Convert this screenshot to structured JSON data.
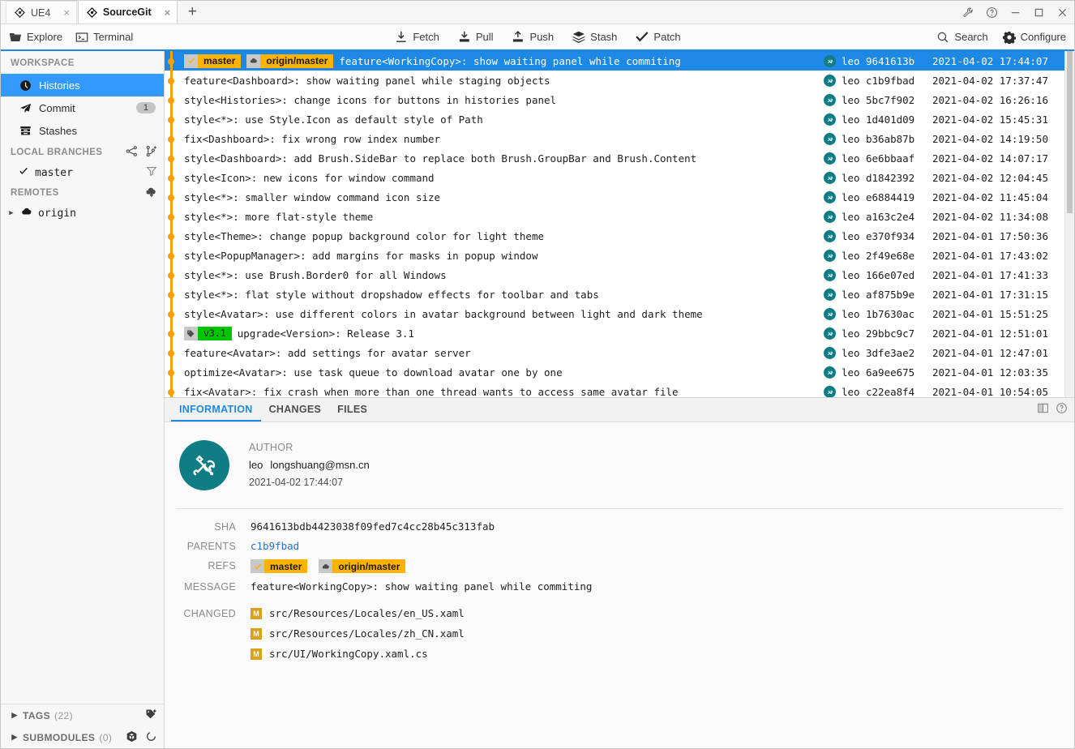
{
  "window": {
    "tabs": [
      {
        "label": "UE4",
        "active": false,
        "icon": "git-logo-icon"
      },
      {
        "label": "SourceGit",
        "active": true,
        "icon": "git-logo-icon"
      }
    ],
    "new_tab_label": "+",
    "close_label": "×",
    "controls": [
      "wrench-icon",
      "help-icon",
      "minimize-icon",
      "maximize-icon",
      "close-icon"
    ]
  },
  "toolbar": {
    "left": [
      {
        "label": "Explore",
        "icon": "folder-icon"
      },
      {
        "label": "Terminal",
        "icon": "terminal-icon"
      }
    ],
    "center": [
      {
        "label": "Fetch",
        "icon": "fetch-icon"
      },
      {
        "label": "Pull",
        "icon": "pull-icon"
      },
      {
        "label": "Push",
        "icon": "push-icon"
      },
      {
        "label": "Stash",
        "icon": "stash-icon"
      },
      {
        "label": "Patch",
        "icon": "patch-icon"
      }
    ],
    "right": [
      {
        "label": "Search",
        "icon": "search-icon"
      },
      {
        "label": "Configure",
        "icon": "gear-icon"
      }
    ]
  },
  "sidebar": {
    "workspace_title": "WORKSPACE",
    "workspace_items": [
      {
        "label": "Histories",
        "icon": "clock-icon",
        "active": true,
        "badge": ""
      },
      {
        "label": "Commit",
        "icon": "paper-plane-icon",
        "active": false,
        "badge": "1"
      },
      {
        "label": "Stashes",
        "icon": "archive-icon",
        "active": false,
        "badge": ""
      }
    ],
    "local_branches_title": "LOCAL BRANCHES",
    "local_branches_actions": [
      "compare-icon",
      "new-branch-icon"
    ],
    "local_branches": [
      {
        "label": "master",
        "current": true,
        "action_icon": "filter-icon"
      }
    ],
    "remotes_title": "REMOTES",
    "remotes_actions": [
      "add-remote-icon"
    ],
    "remotes": [
      {
        "label": "origin",
        "icon": "cloud-icon",
        "expanded": false
      }
    ],
    "tags_title": "TAGS",
    "tags_count": "(22)",
    "tags_actions": [
      "new-tag-icon"
    ],
    "submodules_title": "SUBMODULES",
    "submodules_count": "(0)",
    "submodules_actions": [
      "cube-icon",
      "refresh-icon"
    ]
  },
  "commits": {
    "columns": [
      "graph",
      "subject",
      "author",
      "sha",
      "time"
    ],
    "rows": [
      {
        "subject": "feature<WorkingCopy>: show waiting panel while commiting",
        "author": "leo",
        "sha": "9641613b",
        "time": "2021-04-02 17:44:07",
        "selected": true,
        "decorators": [
          {
            "type": "branch",
            "icon": "check-icon",
            "name": "master"
          },
          {
            "type": "remote",
            "icon": "cloud-icon",
            "name": "origin/master"
          }
        ]
      },
      {
        "subject": "feature<Dashboard>: show waiting panel while staging objects",
        "author": "leo",
        "sha": "c1b9fbad",
        "time": "2021-04-02 17:37:47",
        "selected": false,
        "decorators": []
      },
      {
        "subject": "style<Histories>: change icons for buttons in histories panel",
        "author": "leo",
        "sha": "5bc7f902",
        "time": "2021-04-02 16:26:16",
        "selected": false,
        "decorators": []
      },
      {
        "subject": "style<*>: use Style.Icon as default style of Path",
        "author": "leo",
        "sha": "1d401d09",
        "time": "2021-04-02 15:45:31",
        "selected": false,
        "decorators": []
      },
      {
        "subject": "fix<Dashboard>: fix wrong row index number",
        "author": "leo",
        "sha": "b36ab87b",
        "time": "2021-04-02 14:19:50",
        "selected": false,
        "decorators": []
      },
      {
        "subject": "style<Dashboard>: add Brush.SideBar to replace both Brush.GroupBar and Brush.Content",
        "author": "leo",
        "sha": "6e6bbaaf",
        "time": "2021-04-02 14:07:17",
        "selected": false,
        "decorators": []
      },
      {
        "subject": "style<Icon>: new icons for window command",
        "author": "leo",
        "sha": "d1842392",
        "time": "2021-04-02 12:04:45",
        "selected": false,
        "decorators": []
      },
      {
        "subject": "style<*>: smaller window command icon size",
        "author": "leo",
        "sha": "e6884419",
        "time": "2021-04-02 11:45:04",
        "selected": false,
        "decorators": []
      },
      {
        "subject": "style<*>: more flat-style theme",
        "author": "leo",
        "sha": "a163c2e4",
        "time": "2021-04-02 11:34:08",
        "selected": false,
        "decorators": []
      },
      {
        "subject": "style<Theme>: change popup background color for light theme",
        "author": "leo",
        "sha": "e370f934",
        "time": "2021-04-01 17:50:36",
        "selected": false,
        "decorators": []
      },
      {
        "subject": "style<PopupManager>: add margins for masks in popup window",
        "author": "leo",
        "sha": "2f49e68e",
        "time": "2021-04-01 17:43:02",
        "selected": false,
        "decorators": []
      },
      {
        "subject": "style<*>: use Brush.Border0 for all Windows",
        "author": "leo",
        "sha": "166e07ed",
        "time": "2021-04-01 17:41:33",
        "selected": false,
        "decorators": []
      },
      {
        "subject": "style<*>: flat style without dropshadow effects for toolbar and tabs",
        "author": "leo",
        "sha": "af875b9e",
        "time": "2021-04-01 17:31:15",
        "selected": false,
        "decorators": []
      },
      {
        "subject": "style<Avatar>: use different colors in avatar background between light and dark theme",
        "author": "leo",
        "sha": "1b7630ac",
        "time": "2021-04-01 15:51:25",
        "selected": false,
        "decorators": []
      },
      {
        "subject": "upgrade<Version>: Release 3.1",
        "author": "leo",
        "sha": "29bbc9c7",
        "time": "2021-04-01 12:51:01",
        "selected": false,
        "decorators": [
          {
            "type": "tag",
            "icon": "tag-icon",
            "name": "v3.1"
          }
        ]
      },
      {
        "subject": "feature<Avatar>: add settings for avatar server",
        "author": "leo",
        "sha": "3dfe3ae2",
        "time": "2021-04-01 12:47:01",
        "selected": false,
        "decorators": []
      },
      {
        "subject": "optimize<Avatar>: use task queue to download avatar one by one",
        "author": "leo",
        "sha": "6a9ee675",
        "time": "2021-04-01 12:03:35",
        "selected": false,
        "decorators": []
      },
      {
        "subject": "fix<Avatar>: fix crash when more than one thread wants to access same avatar file",
        "author": "leo",
        "sha": "c22ea8f4",
        "time": "2021-04-01 10:54:05",
        "selected": false,
        "decorators": []
      }
    ]
  },
  "detail": {
    "tabs": [
      {
        "label": "INFORMATION",
        "active": true
      },
      {
        "label": "CHANGES",
        "active": false
      },
      {
        "label": "FILES",
        "active": false
      }
    ],
    "tabs_right": [
      "split-view-icon",
      "help-icon"
    ],
    "author": {
      "label": "AUTHOR",
      "name": "leo",
      "email": "longshuang@msn.cn",
      "time": "2021-04-02 17:44:07"
    },
    "fields": {
      "sha_label": "SHA",
      "sha_value": "9641613bdb4423038f09fed7c4cc28b45c313fab",
      "parents_label": "PARENTS",
      "parents_value": "c1b9fbad",
      "refs_label": "REFS",
      "refs": [
        {
          "type": "branch",
          "icon": "check-icon",
          "name": "master"
        },
        {
          "type": "remote",
          "icon": "cloud-icon",
          "name": "origin/master"
        }
      ],
      "message_label": "MESSAGE",
      "message_value": "feature<WorkingCopy>: show waiting panel while commiting",
      "changed_label": "CHANGED",
      "changed_files": [
        {
          "status": "M",
          "path": "src/Resources/Locales/en_US.xaml"
        },
        {
          "status": "M",
          "path": "src/Resources/Locales/zh_CN.xaml"
        },
        {
          "status": "M",
          "path": "src/UI/WorkingCopy.xaml.cs"
        }
      ]
    }
  },
  "colors": {
    "accent": "#1e88e5",
    "selection": "#1e88e5",
    "sidebar_selection": "#3399ff",
    "graph": "#ffa000",
    "branch_tag": "#ffb300",
    "version_tag": "#00c400",
    "avatar": "#107c84",
    "modified_badge": "#dba11c"
  }
}
